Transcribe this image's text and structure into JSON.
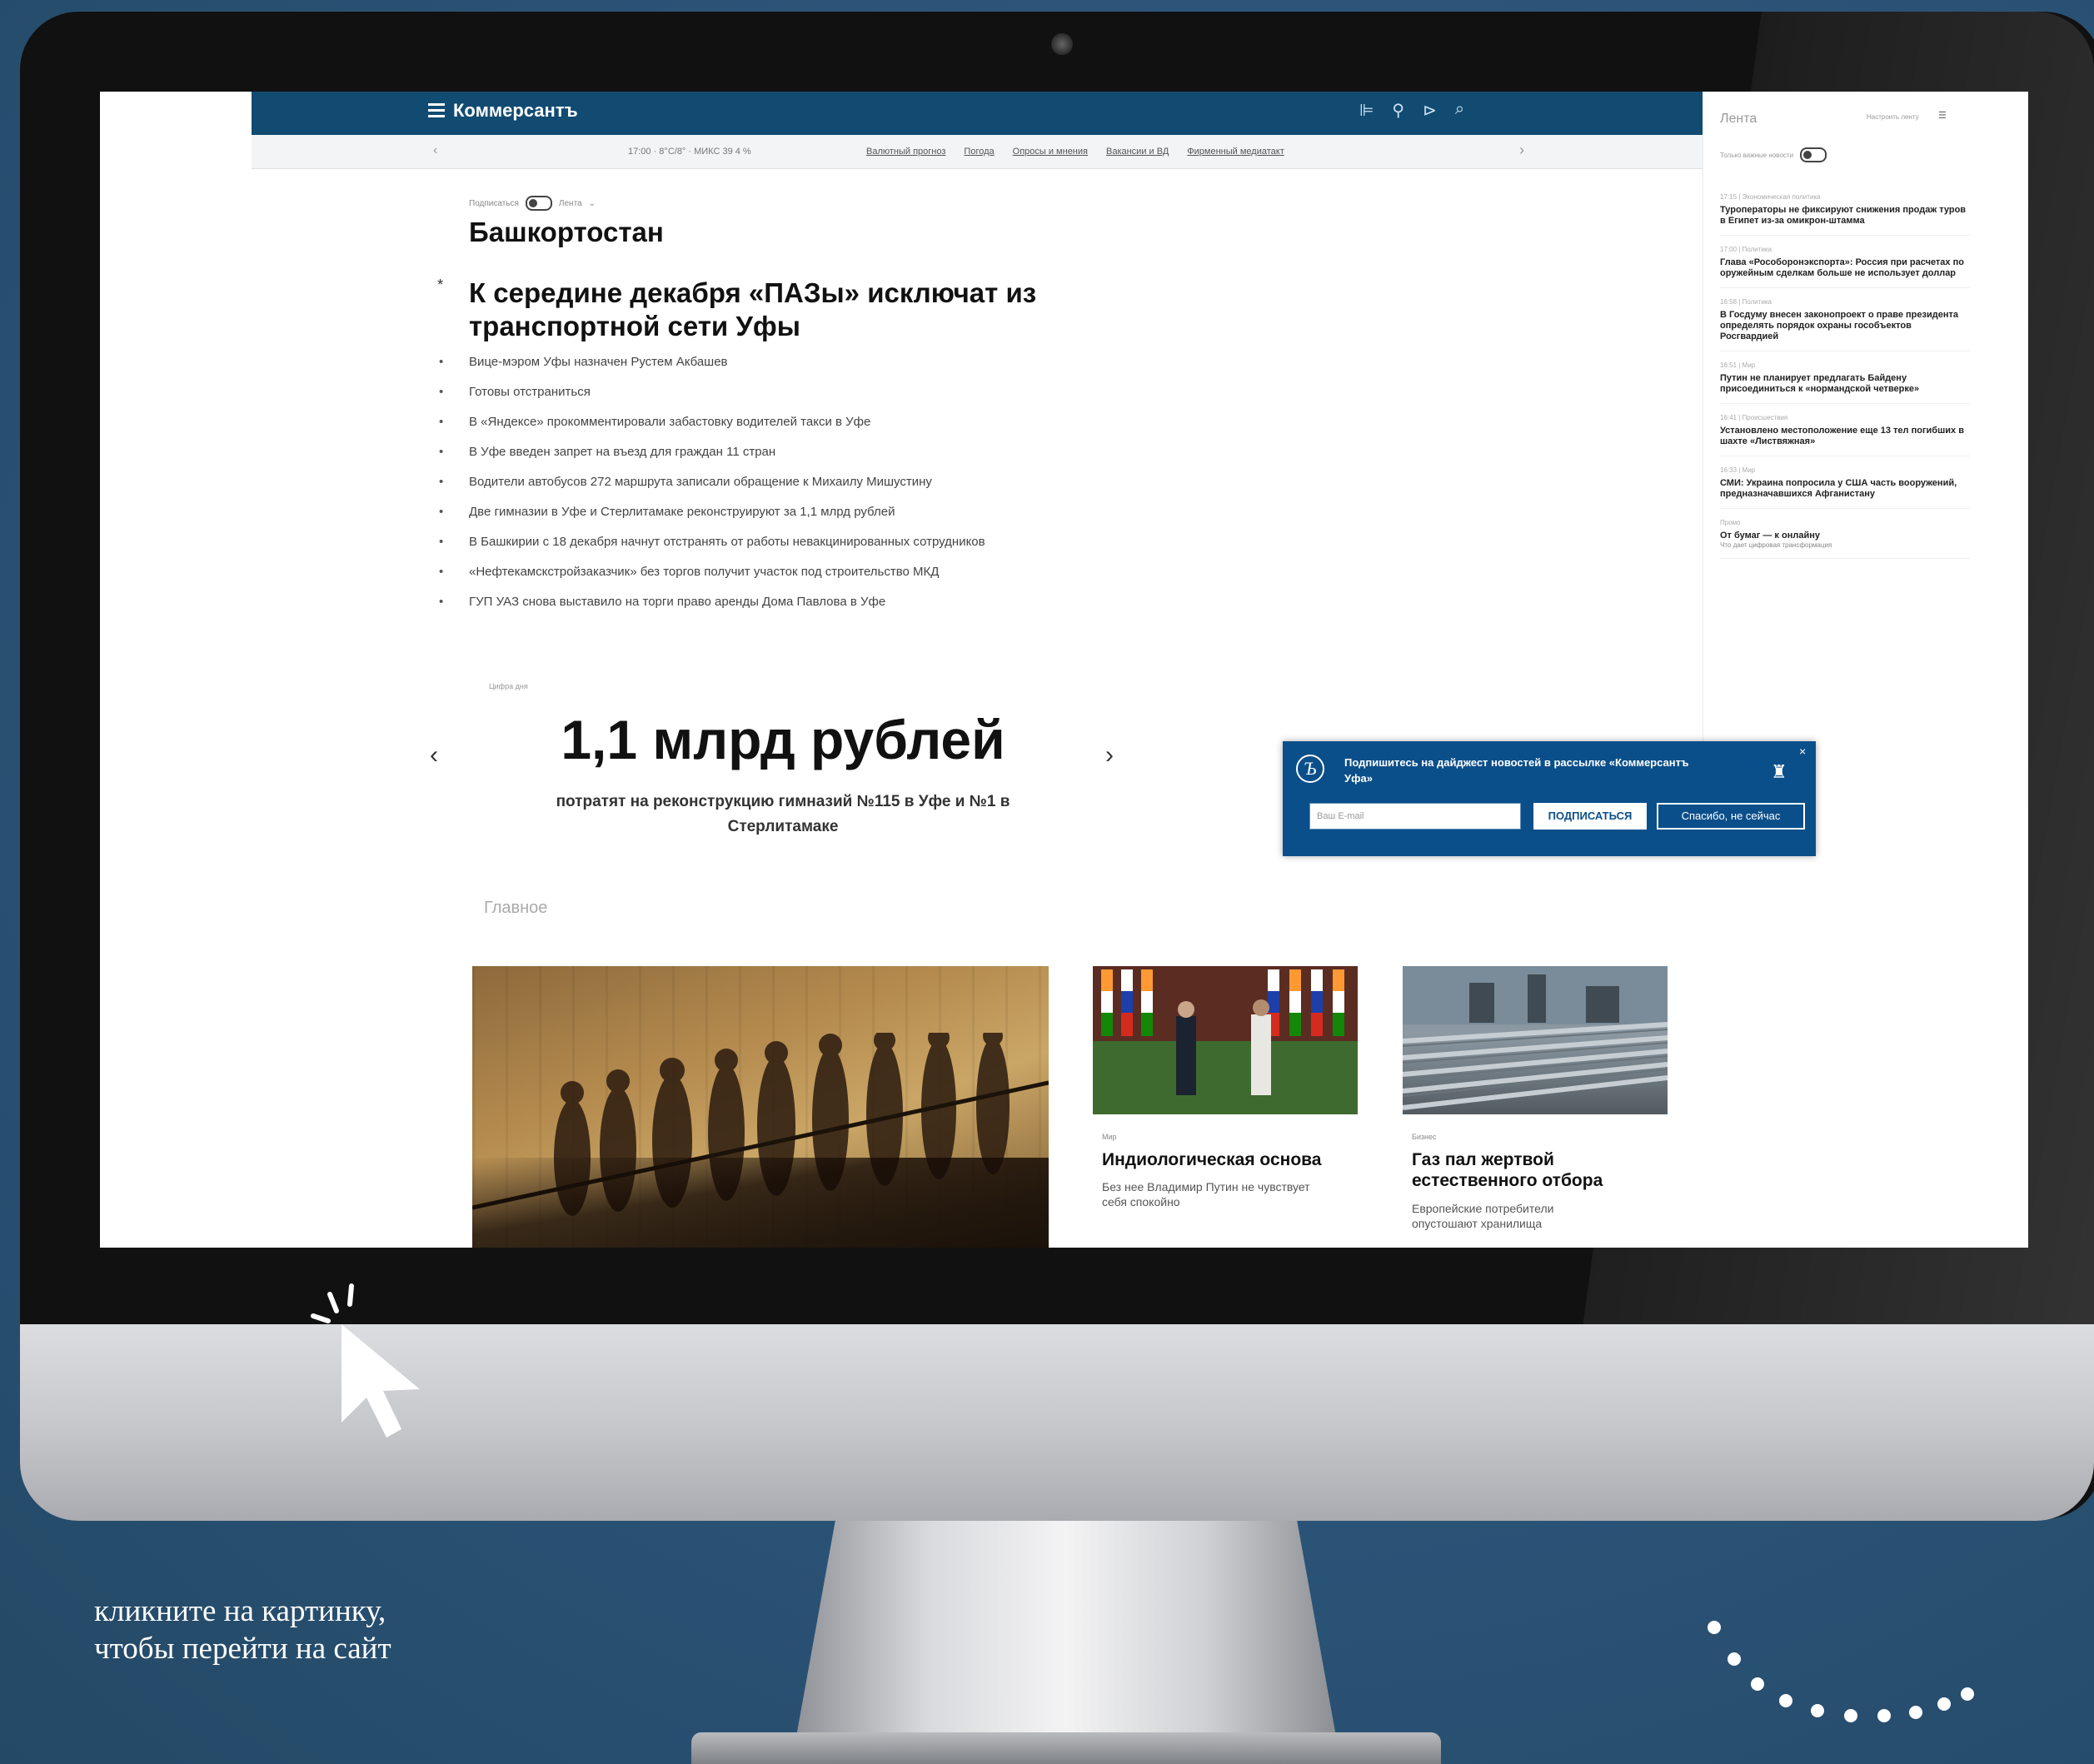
{
  "site": {
    "logo": "Коммерсантъ",
    "subnav_date": "17:00 · 8°C/8° · МИКС 39 4 %",
    "subnav_links": [
      "Валютный прогноз",
      "Погода",
      "Опросы и мнения",
      "Вакансии и ВД",
      "Фирменный медиатакт"
    ]
  },
  "page": {
    "subscribe_label": "Подписаться",
    "feed_label": "Лента",
    "region_title": "Башкортостан",
    "headline": "К середине декабря «ПАЗы» исключат из транспортной сети Уфы",
    "bullets": [
      "Вице-мэром Уфы назначен Рустем Акбашев",
      "Готовы отстраниться",
      "В «Яндексе» прокомментировали забастовку водителей такси в Уфе",
      "В Уфе введен запрет на въезд для граждан 11 стран",
      "Водители автобусов 272 маршрута записали обращение к Михаилу Мишустину",
      "Две гимназии в Уфе и Стерлитамаке реконструируют за 1,1 млрд рублей",
      "В Башкирии с 18 декабря начнут отстранять от работы невакцинированных сотрудников",
      "«Нефтекамскстройзаказчик» без торгов получит участок под строительство МКД",
      "ГУП УАЗ снова выставило на торги право аренды Дома Павлова в Уфе"
    ],
    "fact_small": "Цифра дня",
    "fact_value": "1,1 млрд рублей",
    "fact_desc": "потратят на реконструкцию гимназий №115 в Уфе и №1 в Стерлитамаке",
    "section_title": "Главное",
    "cards": [
      {
        "category": "Мир",
        "title": "Индиологическая основа",
        "lead": "Без нее Владимир Путин не чувствует себя спокойно"
      },
      {
        "category": "Бизнес",
        "title": "Газ пал жертвой естественного отбора",
        "lead": "Европейские потребители опустошают хранилища"
      }
    ]
  },
  "feed": {
    "title": "Лента",
    "option": "Настроить ленту",
    "mode": "Только важные новости",
    "items": [
      {
        "meta": "17:15 | Экономическая политика",
        "text": "Туроператоры не фиксируют снижения продаж туров в Египет из-за омикрон-штамма",
        "sub": ""
      },
      {
        "meta": "17:00 | Политика",
        "text": "Глава «Рособоронэкспорта»: Россия при расчетах по оружейным сделкам больше не использует доллар",
        "sub": ""
      },
      {
        "meta": "16:58 | Политика",
        "text": "В Госдуму внесен законопроект о праве президента определять порядок охраны гособъектов Росгвардией",
        "sub": ""
      },
      {
        "meta": "16:51 | Мир",
        "text": "Путин не планирует предлагать Байдену присоединиться к «нормандской четверке»",
        "sub": ""
      },
      {
        "meta": "16:41 | Происшествия",
        "text": "Установлено местоположение еще 13 тел погибших в шахте «Листвяжная»",
        "sub": ""
      },
      {
        "meta": "16:33 | Мир",
        "text": "СМИ: Украина попросила у США часть вооружений, предназначавшихся Афганистану",
        "sub": ""
      },
      {
        "meta": "Промо",
        "text": "От бумаг — к онлайну",
        "sub": "Что дает цифровая трансформация"
      }
    ]
  },
  "popup": {
    "text": "Подпишитесь на дайджест новостей в рассылке «Коммерсантъ Уфа»",
    "email_placeholder": "Ваш E-mail",
    "subscribe_button": "ПОДПИСАТЬСЯ",
    "decline_button": "Спасибо, не сейчас"
  },
  "promo": {
    "caption_line1": "кликните на картинку,",
    "caption_line2": "чтобы перейти на сайт"
  },
  "colors": {
    "background": "#2c5578",
    "header": "#114b72",
    "popup": "#0b4f8a"
  }
}
